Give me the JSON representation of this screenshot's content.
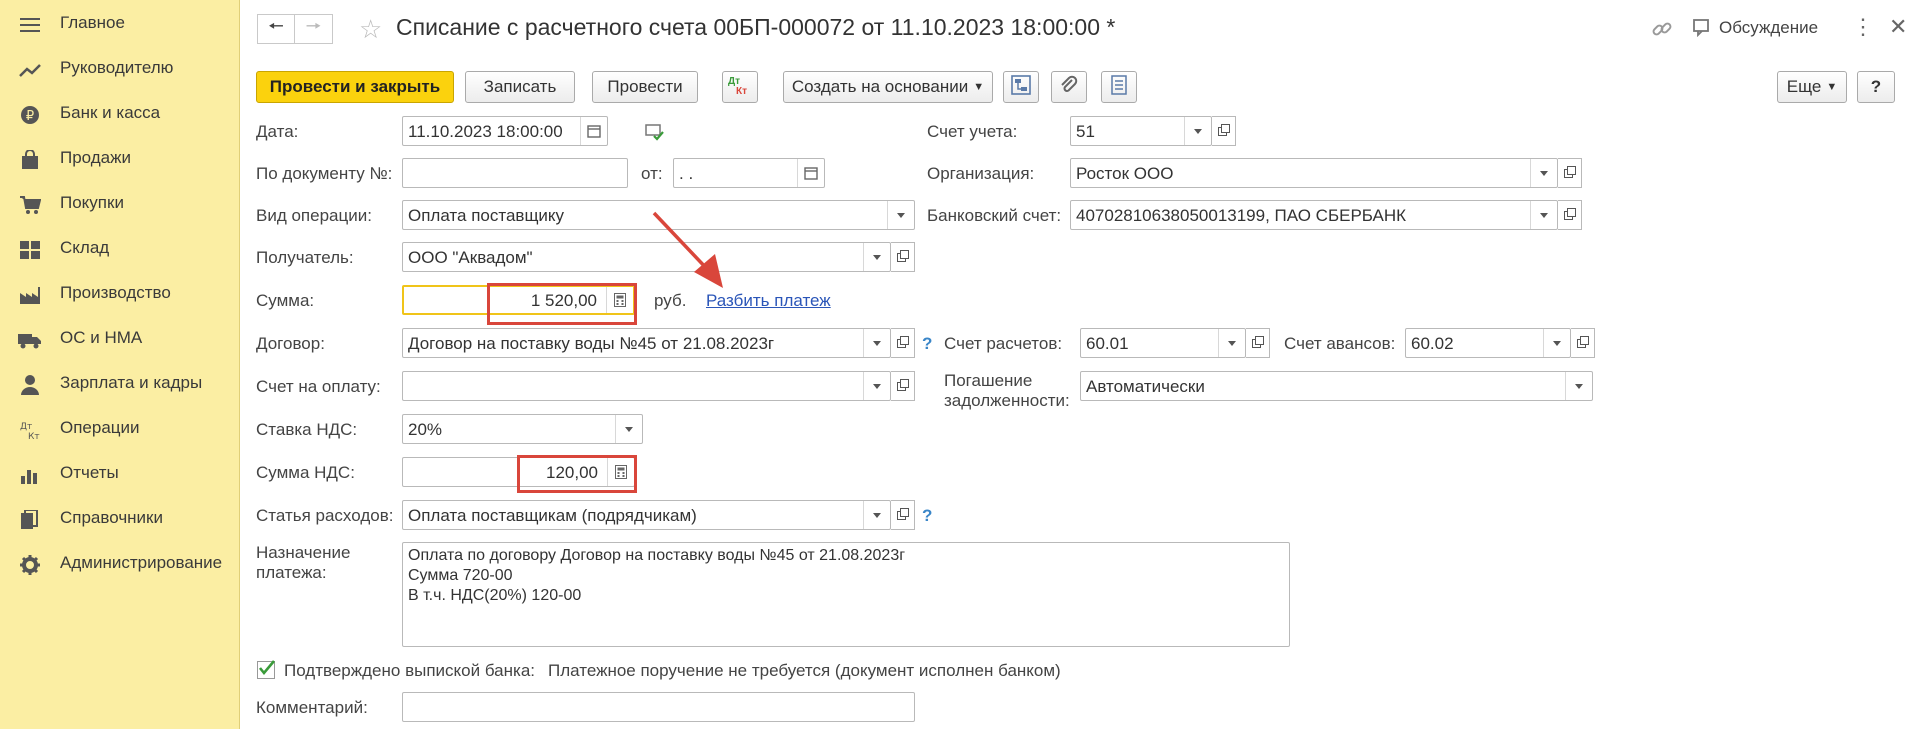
{
  "sidebar": {
    "items": [
      {
        "label": "Главное",
        "icon": "menu-icon"
      },
      {
        "label": "Руководителю",
        "icon": "chart-line-icon"
      },
      {
        "label": "Банк и касса",
        "icon": "ruble-icon"
      },
      {
        "label": "Продажи",
        "icon": "shopping-bag-icon"
      },
      {
        "label": "Покупки",
        "icon": "cart-icon"
      },
      {
        "label": "Склад",
        "icon": "warehouse-icon"
      },
      {
        "label": "Производство",
        "icon": "factory-icon"
      },
      {
        "label": "ОС и НМА",
        "icon": "truck-icon"
      },
      {
        "label": "Зарплата и кадры",
        "icon": "person-icon"
      },
      {
        "label": "Операции",
        "icon": "dt-kt-icon"
      },
      {
        "label": "Отчеты",
        "icon": "bar-chart-icon"
      },
      {
        "label": "Справочники",
        "icon": "books-icon"
      },
      {
        "label": "Администрирование",
        "icon": "gear-icon"
      }
    ]
  },
  "header": {
    "title": "Списание с расчетного счета 00БП-000072 от 11.10.2023 18:00:00 *",
    "discussion": "Обсуждение"
  },
  "toolbar": {
    "post_close": "Провести и закрыть",
    "save": "Записать",
    "post": "Провести",
    "dtkt_top": "Дт",
    "dtkt_bottom": "Кт",
    "create_based": "Создать на основании",
    "more": "Еще",
    "help": "?"
  },
  "form": {
    "date": {
      "label": "Дата:",
      "value": "11.10.2023 18:00:00"
    },
    "doc_number": {
      "label": "По документу №:",
      "value": "",
      "from_label": "от:",
      "from_value": " .  ."
    },
    "operation": {
      "label": "Вид операции:",
      "value": "Оплата поставщику"
    },
    "recipient": {
      "label": "Получатель:",
      "value": "ООО \"Аквадом\""
    },
    "amount": {
      "label": "Сумма:",
      "value": "1 520,00",
      "currency": "руб.",
      "split_link": "Разбить платеж"
    },
    "contract": {
      "label": "Договор:",
      "value": "Договор на поставку воды №45 от 21.08.2023г"
    },
    "invoice": {
      "label": "Счет на оплату:",
      "value": ""
    },
    "vat_rate": {
      "label": "Ставка НДС:",
      "value": "20%"
    },
    "vat_amount": {
      "label": "Сумма НДС:",
      "value": "120,00"
    },
    "expense": {
      "label": "Статья расходов:",
      "value": "Оплата поставщикам (подрядчикам)"
    },
    "purpose": {
      "label_line1": "Назначение",
      "label_line2": "платежа:",
      "line1": "Оплата по договору Договор на поставку воды №45 от 21.08.2023г",
      "line2": "Сумма 720-00",
      "line3": "В т.ч. НДС(20%) 120-00"
    },
    "confirmed": {
      "label": "Подтверждено выпиской банка:",
      "checked": true,
      "note": "Платежное поручение не требуется (документ исполнен банком)"
    },
    "comment": {
      "label": "Комментарий:",
      "value": ""
    },
    "account": {
      "label": "Счет учета:",
      "value": "51"
    },
    "organization": {
      "label": "Организация:",
      "value": "Росток ООО"
    },
    "bank_account": {
      "label": "Банковский счет:",
      "value": "40702810638050013199, ПАО СБЕРБАНК"
    },
    "settlement_account": {
      "label": "Счет расчетов:",
      "value": "60.01"
    },
    "advance_account": {
      "label": "Счет авансов:",
      "value": "60.02"
    },
    "debt_repayment": {
      "label_line1": "Погашение",
      "label_line2": "задолженности:",
      "value": "Автоматически"
    }
  },
  "colors": {
    "sidebar_bg": "#fbeea3",
    "primary_button": "#fbd20d",
    "highlight": "#d9463b",
    "link": "#2a55b8"
  }
}
